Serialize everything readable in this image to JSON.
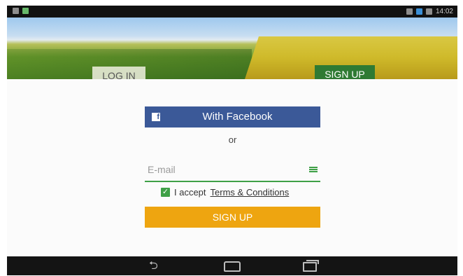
{
  "status_bar": {
    "time": "14:02",
    "icons": [
      "notification-icon",
      "android-icon",
      "wifi-icon",
      "signal-icon",
      "battery-icon"
    ]
  },
  "tabs": {
    "login_label": "LOG IN",
    "signup_label": "SIGN UP",
    "active": "signup"
  },
  "form": {
    "facebook_label": "With Facebook",
    "or_text": "or",
    "email_placeholder": "E-mail",
    "accept_text": "I accept",
    "terms_link": "Terms & Conditions",
    "accept_checked": true,
    "signup_button": "SIGN UP"
  },
  "nav_bar": {
    "icons": [
      "back-icon",
      "home-icon",
      "recent-apps-icon"
    ]
  },
  "colors": {
    "facebook": "#3b5998",
    "accent_green": "#3fa047",
    "signup_orange": "#eea510",
    "tab_active": "#2f7a33"
  }
}
